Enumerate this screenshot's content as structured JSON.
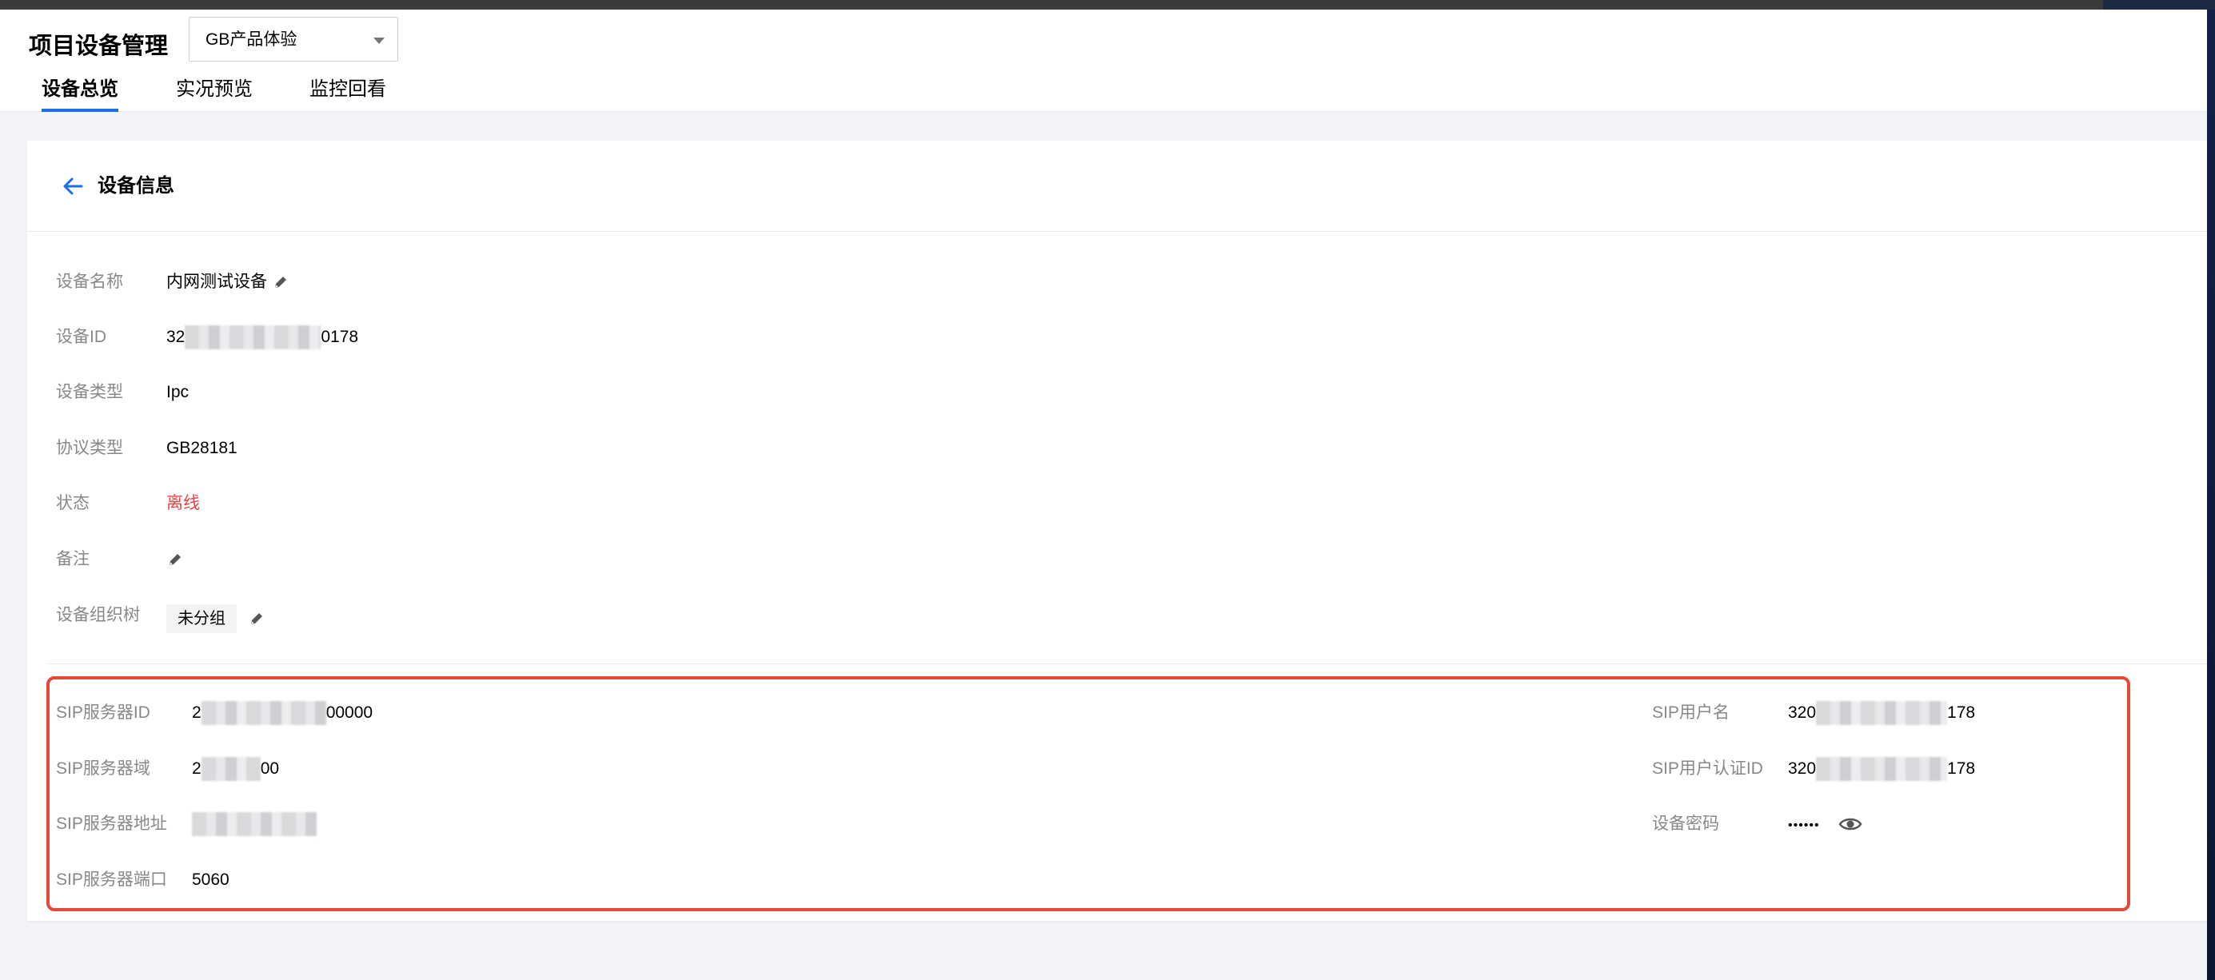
{
  "header": {
    "title": "项目设备管理",
    "project_select": {
      "value": "GB产品体验"
    },
    "tabs": [
      {
        "label": "设备总览",
        "active": true
      },
      {
        "label": "实况预览",
        "active": false
      },
      {
        "label": "监控回看",
        "active": false
      }
    ]
  },
  "card": {
    "title": "设备信息",
    "back_icon": "arrow-left-icon"
  },
  "device_info": {
    "name_label": "设备名称",
    "name_value": "内网测试设备",
    "id_label": "设备ID",
    "id_prefix": "32",
    "id_suffix": "0178",
    "type_label": "设备类型",
    "type_value": "Ipc",
    "protocol_label": "协议类型",
    "protocol_value": "GB28181",
    "status_label": "状态",
    "status_value": "离线",
    "remark_label": "备注",
    "org_label": "设备组织树",
    "org_value": "未分组"
  },
  "sip": {
    "server_id_label": "SIP服务器ID",
    "server_id_prefix": "2",
    "server_id_suffix": "00000",
    "server_domain_label": "SIP服务器域",
    "server_domain_prefix": "2",
    "server_domain_suffix": "00",
    "server_addr_label": "SIP服务器地址",
    "server_port_label": "SIP服务器端口",
    "server_port_value": "5060",
    "username_label": "SIP用户名",
    "username_prefix": "320",
    "username_suffix": "178",
    "auth_id_label": "SIP用户认证ID",
    "auth_id_prefix": "320",
    "auth_id_suffix": "178",
    "password_label": "设备密码",
    "password_value": "••••••"
  },
  "colors": {
    "accent": "#1a6ee6",
    "status_offline": "#e54545",
    "highlight_border": "#e34a3b"
  }
}
